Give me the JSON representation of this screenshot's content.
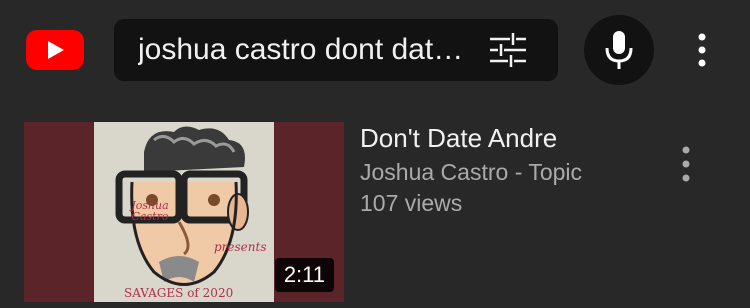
{
  "header": {
    "logo_icon": "youtube-logo-icon",
    "search": {
      "query": "joshua castro dont dat…",
      "filter_icon": "filter-sliders-icon"
    },
    "mic_icon": "microphone-icon",
    "more_icon": "more-vertical-icon"
  },
  "results": [
    {
      "title": "Don't Date Andre",
      "channel": "Joshua Castro - Topic",
      "views": "107 views",
      "duration": "2:11",
      "thumbnail": {
        "artist_text": "Joshua Castro",
        "presents_text": "presents",
        "album_text": "SAVAGES of 2020"
      },
      "more_icon": "more-vertical-icon"
    }
  ],
  "colors": {
    "background": "#282828",
    "search_bg": "#121212",
    "brand_red": "#ff0000",
    "secondary_text": "#aaaaaa",
    "thumb_border": "#5a2428"
  }
}
